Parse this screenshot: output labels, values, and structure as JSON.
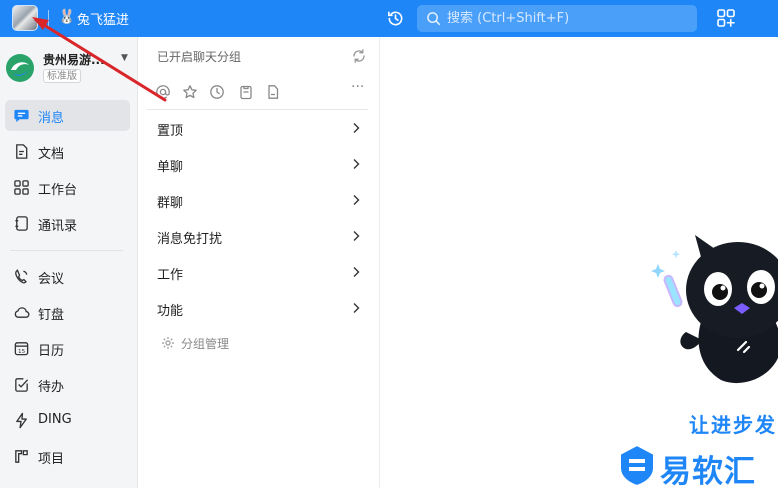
{
  "topbar": {
    "status_emoji": "🐰",
    "status_text": "兔飞猛进",
    "search_placeholder": "搜索 (Ctrl+Shift+F)"
  },
  "org": {
    "name": "贵州易游...",
    "badge": "标准版"
  },
  "sidebar": {
    "items": [
      {
        "label": "消息",
        "icon": "message-icon",
        "active": true
      },
      {
        "label": "文档",
        "icon": "document-icon"
      },
      {
        "label": "工作台",
        "icon": "workbench-icon"
      },
      {
        "label": "通讯录",
        "icon": "contacts-icon"
      },
      {
        "label": "会议",
        "icon": "meeting-icon"
      },
      {
        "label": "钉盘",
        "icon": "cloud-drive-icon"
      },
      {
        "label": "日历",
        "icon": "calendar-icon"
      },
      {
        "label": "待办",
        "icon": "todo-icon"
      },
      {
        "label": "DING",
        "icon": "ding-icon"
      },
      {
        "label": "项目",
        "icon": "project-icon"
      }
    ]
  },
  "middle": {
    "title": "已开启聊天分组",
    "groups": [
      {
        "label": "置顶"
      },
      {
        "label": "单聊"
      },
      {
        "label": "群聊"
      },
      {
        "label": "消息免打扰"
      },
      {
        "label": "工作"
      },
      {
        "label": "功能"
      }
    ],
    "manage_label": "分组管理"
  },
  "main": {
    "slogan": "让进步发",
    "watermark": "易软汇"
  },
  "colors": {
    "accent": "#1f86f7",
    "sidebar_bg": "#f4f5f7"
  }
}
